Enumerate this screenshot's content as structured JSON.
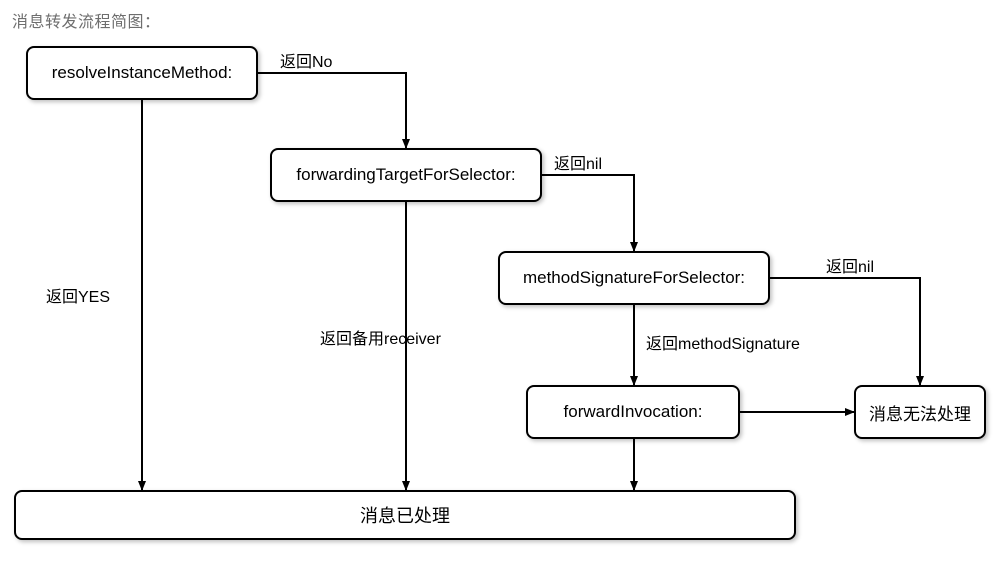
{
  "title": "消息转发流程简图：",
  "nodes": {
    "resolve": "resolveInstanceMethod:",
    "forwardingTarget": "forwardingTargetForSelector:",
    "methodSignature": "methodSignatureForSelector:",
    "forwardInvocation": "forwardInvocation:",
    "unhandled": "消息无法处理",
    "handled": "消息已处理"
  },
  "edges": {
    "resolve_no": "返回No",
    "resolve_yes": "返回YES",
    "forwardingTarget_nil": "返回nil",
    "forwardingTarget_receiver": "返回备用receiver",
    "methodSignature_nil": "返回nil",
    "methodSignature_sig": "返回methodSignature"
  }
}
